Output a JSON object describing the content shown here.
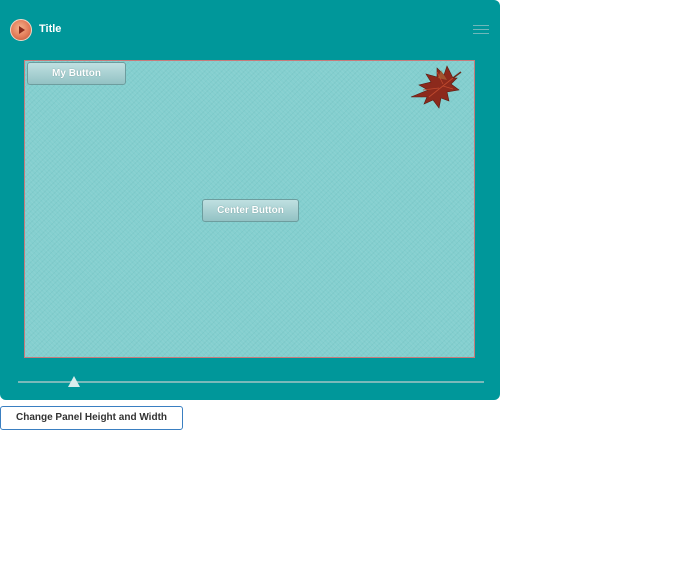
{
  "window": {
    "title": "Title"
  },
  "panel": {
    "my_button_label": "My Button",
    "center_button_label": "Center Button",
    "decor_icon": "maple-leaf-icon"
  },
  "slider": {
    "value": 0.12
  },
  "controls": {
    "change_button_label": "Change Panel Height and Width"
  },
  "colors": {
    "window_bg": "#00979a",
    "panel_bg": "#84cfcf",
    "panel_border": "#c77b7b",
    "button_bg": "#a9d2d3",
    "change_button_border": "#3a7fc1"
  }
}
